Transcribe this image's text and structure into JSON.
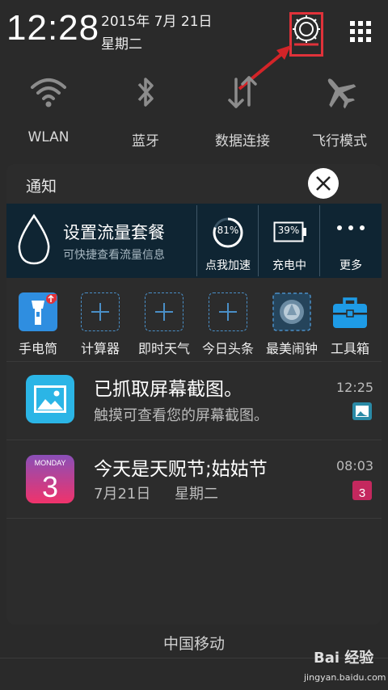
{
  "status": {
    "time": "12:28",
    "date": "2015年 7月 21日",
    "weekday": "星期二"
  },
  "quick_toggles": [
    {
      "label": "WLAN",
      "icon": "wifi-icon"
    },
    {
      "label": "蓝牙",
      "icon": "bluetooth-icon"
    },
    {
      "label": "数据连接",
      "icon": "data-arrows-icon"
    },
    {
      "label": "飞行模式",
      "icon": "airplane-icon"
    }
  ],
  "panel": {
    "title": "通知",
    "flow": {
      "title": "设置流量套餐",
      "subtitle": "可快捷查看流量信息"
    },
    "boost": {
      "percent": "81%",
      "label": "点我加速",
      "value": 0.81
    },
    "charge": {
      "percent": "39%",
      "label": "充电中",
      "value": 0.39
    },
    "more": {
      "label": "更多"
    }
  },
  "apps": [
    {
      "label": "手电筒",
      "icon": "flashlight-icon"
    },
    {
      "label": "计算器",
      "icon": "add-placeholder-icon"
    },
    {
      "label": "即时天气",
      "icon": "add-placeholder-icon"
    },
    {
      "label": "今日头条",
      "icon": "add-placeholder-icon"
    },
    {
      "label": "最美闹钟",
      "icon": "alarm-icon"
    },
    {
      "label": "工具箱",
      "icon": "toolbox-icon"
    }
  ],
  "notifications": [
    {
      "title": "已抓取屏幕截图。",
      "subtitle": "触摸可查看您的屏幕截图。",
      "time": "12:25",
      "icon": "screenshot-icon"
    },
    {
      "title": "今天是天贶节;姑姑节",
      "subtitle_date": "7月21日",
      "subtitle_weekday": "星期二",
      "time": "08:03",
      "icon": "calendar-icon",
      "icon_month": "MONDAY",
      "icon_day": "3"
    }
  ],
  "carrier": "中国移动",
  "watermark": {
    "text": "Bai 经验",
    "sub": "jingyan.baidu.com"
  },
  "colors": {
    "background": "#2a2a2a",
    "dark_bar": "#0f2533",
    "accent_red": "#e0323a",
    "accent_blue": "#4a8fc7"
  }
}
